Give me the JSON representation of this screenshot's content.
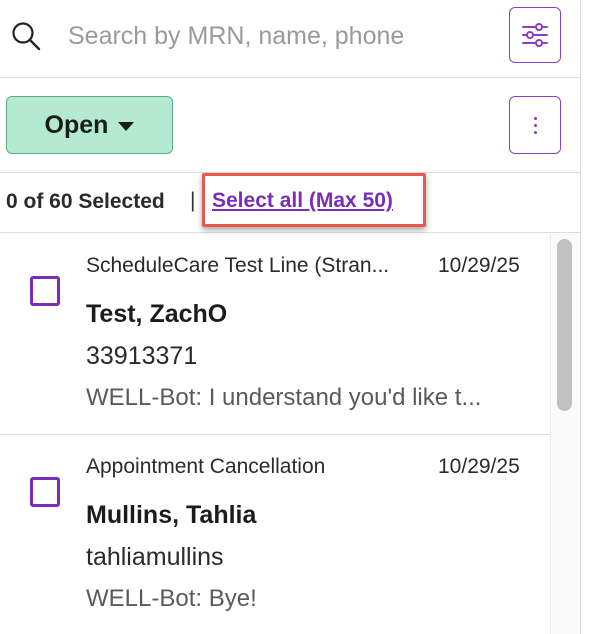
{
  "search": {
    "placeholder": "Search by MRN, name, phone",
    "value": "",
    "icon": "search-icon"
  },
  "filter_button": {
    "icon": "sliders-icon"
  },
  "status_dropdown": {
    "label": "Open",
    "icon": "caret-down-icon"
  },
  "more_button": {
    "icon": "vertical-dots-icon"
  },
  "selection": {
    "count_text": "0 of 60 Selected",
    "separator": "|",
    "select_all_label": "Select all (Max 50)"
  },
  "items": [
    {
      "title": "ScheduleCare Test Line (Stran...",
      "date": "10/29/25",
      "name": "Test, ZachO",
      "identifier": "33913371",
      "preview": "WELL-Bot: I understand you'd like t..."
    },
    {
      "title": "Appointment Cancellation",
      "date": "10/29/25",
      "name": "Mullins, Tahlia",
      "identifier": "tahliamullins",
      "preview": "WELL-Bot: Bye!"
    }
  ],
  "colors": {
    "accent_purple": "#7a2db8",
    "status_green_bg": "#b4ead0",
    "highlight_red": "#e85a4f"
  }
}
